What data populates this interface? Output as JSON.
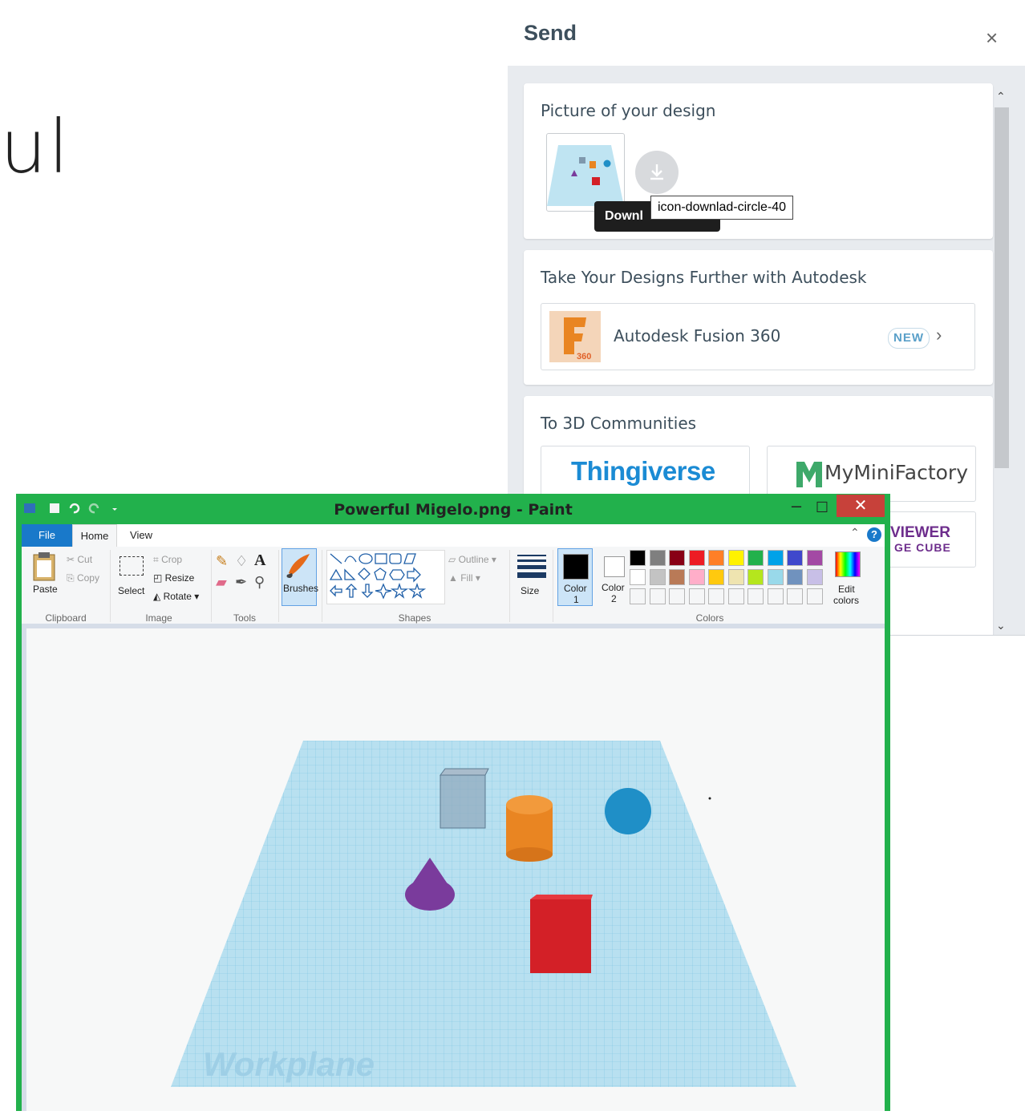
{
  "background": {
    "partial_text": "ul"
  },
  "send_panel": {
    "title": "Send",
    "close_glyph": "×",
    "picture_card": {
      "title": "Picture of your design",
      "download_tooltip_visible": "Downl",
      "icon_tooltip": "icon-downlad-circle-40",
      "download_icon": "download-circle-icon"
    },
    "autodesk_card": {
      "title": "Take Your Designs Further with Autodesk",
      "product_name": "Autodesk Fusion 360",
      "logo_letter": "F",
      "logo_number": "360",
      "badge": "NEW",
      "chevron": "›"
    },
    "communities_card": {
      "title": "To 3D Communities",
      "items": [
        {
          "name": "Thingiverse"
        },
        {
          "name": "MyMiniFactory",
          "logo_letter": "M"
        },
        {
          "name_line1": "VIEWER",
          "name_line2": "GE CUBE"
        }
      ]
    }
  },
  "paint": {
    "title": "Powerful Migelo.png - Paint",
    "window_buttons": {
      "minimize": "–",
      "maximize": "☐",
      "close": "✕"
    },
    "tabs": [
      "File",
      "Home",
      "View"
    ],
    "help": "?",
    "clipboard": {
      "paste": "Paste",
      "cut": "Cut",
      "copy": "Copy",
      "group": "Clipboard"
    },
    "image": {
      "select": "Select",
      "crop": "Crop",
      "resize": "Resize",
      "rotate": "Rotate",
      "group": "Image"
    },
    "tools": {
      "group": "Tools",
      "text_tool": "A"
    },
    "brushes": {
      "label": "Brushes"
    },
    "shapes": {
      "outline": "Outline",
      "fill": "Fill",
      "group": "Shapes"
    },
    "size": {
      "label": "Size"
    },
    "colors": {
      "color1_label": "Color",
      "color1_num": "1",
      "color2_label": "Color",
      "color2_num": "2",
      "edit_line1": "Edit",
      "edit_line2": "colors",
      "group": "Colors",
      "color1": "#000000",
      "color2": "#ffffff",
      "palette_row1": [
        "#000000",
        "#7f7f7f",
        "#880015",
        "#ed1c24",
        "#ff7f27",
        "#fff200",
        "#22b14c",
        "#00a2e8",
        "#3f48cc",
        "#a349a4"
      ],
      "palette_row2": [
        "#ffffff",
        "#c3c3c3",
        "#b97a57",
        "#ffaec9",
        "#ffc90e",
        "#efe4b0",
        "#b5e61d",
        "#99d9ea",
        "#7092be",
        "#c8bfe7"
      ]
    },
    "canvas_watermark": "Workplane"
  }
}
